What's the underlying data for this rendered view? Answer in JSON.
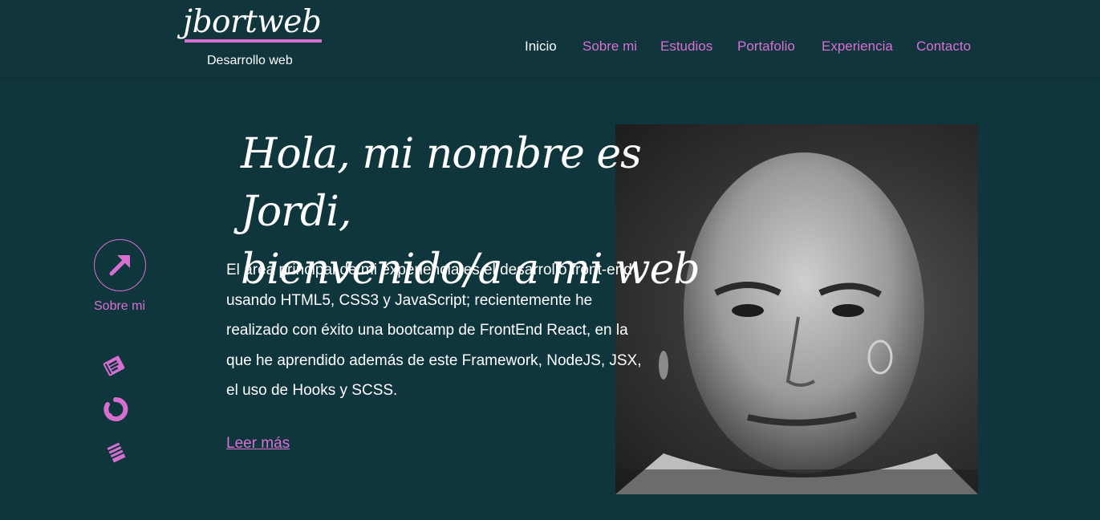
{
  "header": {
    "logo_text": "jbortweb",
    "logo_subtitle": "Desarrollo web"
  },
  "nav": {
    "items": [
      {
        "label": "Inicio",
        "active": true
      },
      {
        "label": "Sobre mi",
        "active": false
      },
      {
        "label": "Estudios",
        "active": false
      },
      {
        "label": "Portafolio",
        "active": false
      },
      {
        "label": "Experiencia",
        "active": false
      },
      {
        "label": "Contacto",
        "active": false
      }
    ]
  },
  "side": {
    "button_icon": "arrow-up-right-icon",
    "button_label": "Sobre mi",
    "icons": [
      "book-icon",
      "spinner-icon",
      "stack-icon"
    ]
  },
  "hero": {
    "title_line1": "Hola, mi nombre es Jordi,",
    "title_line2": "bienvenido/a a mi web",
    "text": "El área principal de mi experiencia es el desarrollo front-end usando HTML5, CSS3 y JavaScript; recientemente he realizado con éxito una bootcamp de FrontEnd React, en la que he aprendido además de este Framework, NodeJS, JSX, el uso de Hooks y SCSS.",
    "read_more": "Leer más"
  },
  "colors": {
    "background": "#10363d",
    "accent": "#d66fd0",
    "text": "#ffffff"
  }
}
